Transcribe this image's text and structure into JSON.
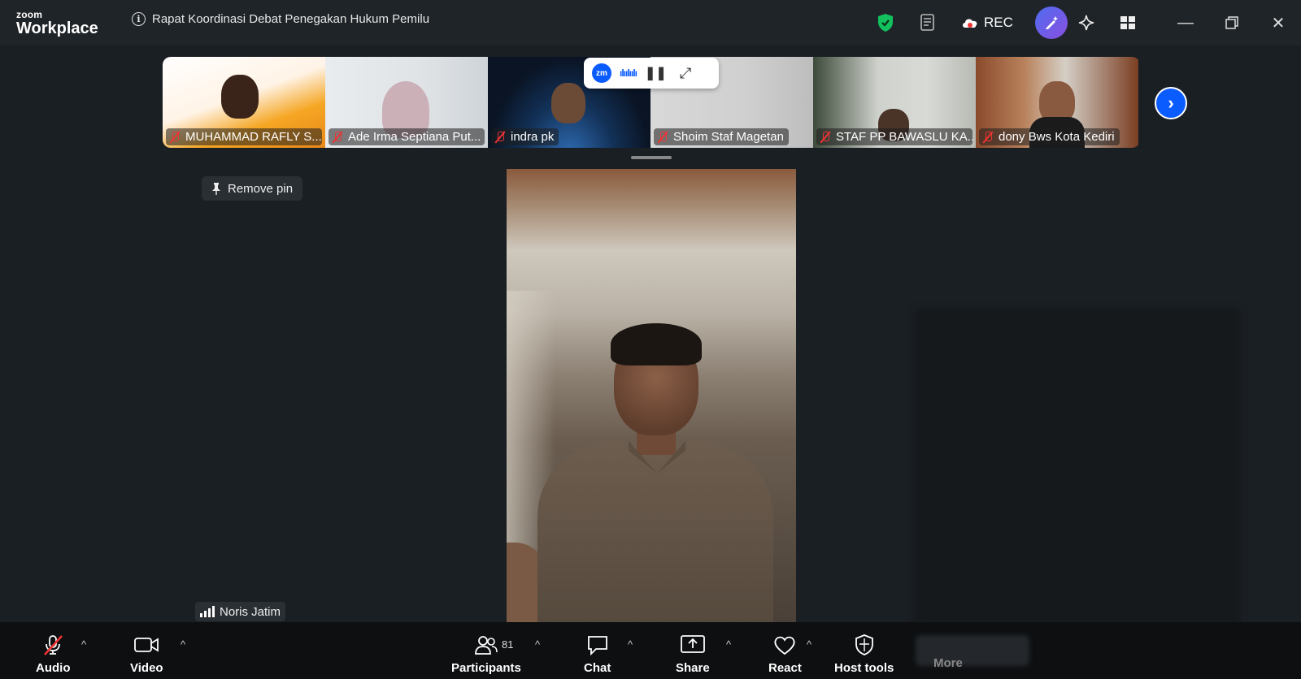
{
  "app": {
    "logo_small": "zoom",
    "logo_big": "Workplace"
  },
  "meeting": {
    "title": "Rapat Koordinasi Debat Penegakan Hukum Pemilu"
  },
  "header": {
    "rec_label": "REC"
  },
  "participants_strip": [
    {
      "name": "MUHAMMAD RAFLY S..."
    },
    {
      "name": "Ade Irma Septiana Put..."
    },
    {
      "name": "indra pk"
    },
    {
      "name": "Shoim Staf Magetan"
    },
    {
      "name": "STAF PP BAWASLU KA..."
    },
    {
      "name": "dony Bws Kota Kediri"
    }
  ],
  "zm_widget": {
    "badge": "zm"
  },
  "pin": {
    "label": "Remove pin"
  },
  "active_speaker": {
    "name": "Noris Jatim"
  },
  "toolbar": {
    "audio": "Audio",
    "video": "Video",
    "participants": "Participants",
    "participant_count": "81",
    "chat": "Chat",
    "share": "Share",
    "react": "React",
    "host_tools": "Host tools",
    "more": "More"
  },
  "colors": {
    "accent": "#0b5cff",
    "mute_red": "#e33333",
    "shield_green": "#12c15d"
  }
}
